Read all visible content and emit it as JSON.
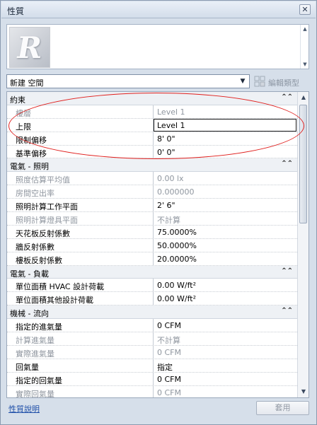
{
  "window": {
    "title": "性質",
    "close_glyph": "✕"
  },
  "type_selector": {
    "value": "新建 空間",
    "arrow": "▼"
  },
  "edit_type": {
    "label": "編輯類型"
  },
  "categories": [
    {
      "label": "約束",
      "collapse": "⌃⌃",
      "rows": [
        {
          "name": "樓層",
          "value": "Level 1",
          "dim": true
        },
        {
          "name": "上限",
          "value": "Level 1",
          "dim": false,
          "editing": true
        },
        {
          "name": "限制偏移",
          "value": "8'  0\"",
          "dim": false
        },
        {
          "name": "基準偏移",
          "value": "0'  0\"",
          "dim": false
        }
      ]
    },
    {
      "label": "電氣 - 照明",
      "collapse": "⌃⌃",
      "rows": [
        {
          "name": "照度估算平均值",
          "value": "0.00 lx",
          "dim": true
        },
        {
          "name": "房間空出率",
          "value": "0.000000",
          "dim": true
        },
        {
          "name": "照明計算工作平面",
          "value": "2'  6\"",
          "dim": false
        },
        {
          "name": "照明計算燈具平面",
          "value": "不計算",
          "dim": true
        },
        {
          "name": "天花板反射係數",
          "value": "75.0000%",
          "dim": false
        },
        {
          "name": "牆反射係數",
          "value": "50.0000%",
          "dim": false
        },
        {
          "name": "樓板反射係數",
          "value": "20.0000%",
          "dim": false
        }
      ]
    },
    {
      "label": "電氣 - 負載",
      "collapse": "⌃⌃",
      "rows": [
        {
          "name": "單位面積 HVAC 設計荷載",
          "value": "0.00 W/ft²",
          "dim": false
        },
        {
          "name": "單位面積其他設計荷載",
          "value": "0.00 W/ft²",
          "dim": false
        }
      ]
    },
    {
      "label": "機械 - 流向",
      "collapse": "⌃⌃",
      "rows": [
        {
          "name": "指定的進氣量",
          "value": "0 CFM",
          "dim": false
        },
        {
          "name": "計算進氣量",
          "value": "不計算",
          "dim": true
        },
        {
          "name": "實際進氣量",
          "value": "0 CFM",
          "dim": true
        },
        {
          "name": "回氣量",
          "value": "指定",
          "dim": false
        },
        {
          "name": "指定的回氣量",
          "value": "0 CFM",
          "dim": false
        },
        {
          "name": "實際回氣量",
          "value": "0 CFM",
          "dim": true
        }
      ]
    }
  ],
  "footer": {
    "help_link": "性質說明",
    "apply_label": "套用"
  },
  "colors": {
    "annotation": "#e0201e",
    "link": "#1f4fa8",
    "dim_text": "#8f969f"
  }
}
